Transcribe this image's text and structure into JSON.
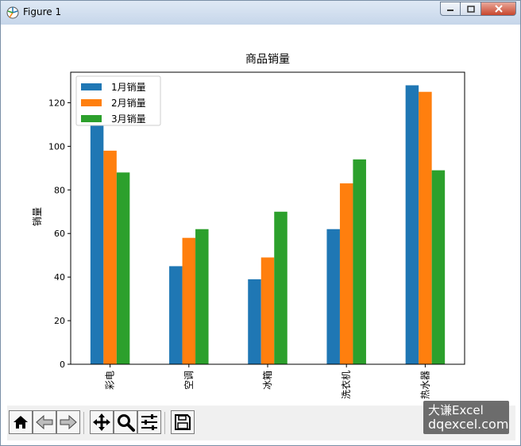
{
  "window": {
    "title": "Figure 1"
  },
  "chart_data": {
    "type": "bar",
    "title": "商品销量",
    "xlabel": "",
    "ylabel": "销量",
    "categories": [
      "彩电",
      "空调",
      "冰箱",
      "洗衣机",
      "热水器"
    ],
    "series": [
      {
        "name": "1月销量",
        "values": [
          110,
          45,
          39,
          62,
          128
        ],
        "color": "#1f77b4"
      },
      {
        "name": "2月销量",
        "values": [
          98,
          58,
          49,
          83,
          125
        ],
        "color": "#ff7f0e"
      },
      {
        "name": "3月销量",
        "values": [
          88,
          62,
          70,
          94,
          89
        ],
        "color": "#2ca02c"
      }
    ],
    "ylim": [
      0,
      134
    ],
    "yticks": [
      0,
      20,
      40,
      60,
      80,
      100,
      120
    ],
    "grid": false,
    "legend": "top-left"
  },
  "toolbar": {
    "items": [
      "home-icon",
      "back-icon",
      "forward-icon",
      "pan-icon",
      "zoom-icon",
      "configure-subplots-icon",
      "save-icon"
    ]
  },
  "watermark": {
    "line1": "大谦Excel",
    "line2": "dqexcel.com"
  }
}
